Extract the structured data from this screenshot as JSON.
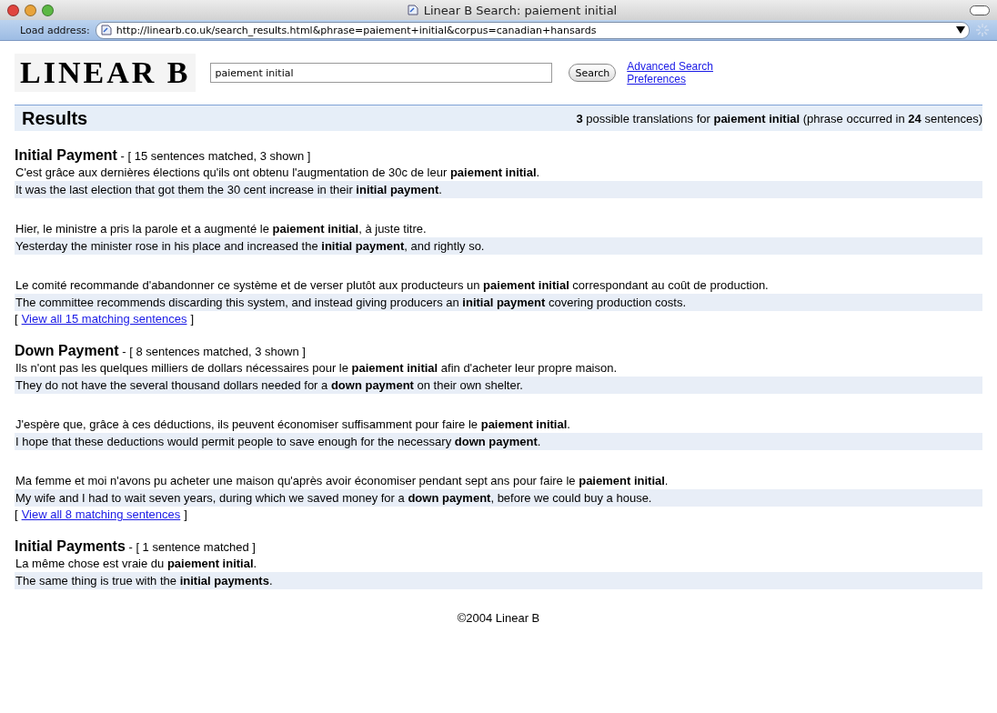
{
  "window": {
    "title": "Linear B Search: paiement initial"
  },
  "address_bar": {
    "label": "Load address:",
    "url": "http://linearb.co.uk/search_results.html&phrase=paiement+initial&corpus=canadian+hansards"
  },
  "logo": "LINEAR B",
  "search": {
    "value": "paiement initial",
    "button": "Search"
  },
  "links": [
    "Advanced Search",
    "Preferences"
  ],
  "results_header": {
    "title": "Results",
    "summary": "**3** possible translations for **paiement initial** (phrase occurred in **24** sentences)"
  },
  "translations": [
    {
      "title": "Initial Payment",
      "matched": " - [ 15 sentences matched, 3 shown ]",
      "sentences": [
        {
          "source": "C'est grâce aux dernières élections qu'ils ont obtenu l'augmentation de 30c de leur **paiement initial**.",
          "target": "It was the last election that got them the 30 cent increase in their **initial payment**."
        },
        {
          "source": "Hier, le ministre a pris la parole et a augmenté le **paiement initial**, à juste titre.",
          "target": "Yesterday the minister rose in his place and increased the **initial payment**, and rightly so."
        },
        {
          "source": "Le comité recommande d'abandonner ce système et de verser plutôt aux producteurs un **paiement initial** correspondant au coût de production.",
          "target": "The committee recommends discarding this system, and instead giving producers an **initial payment** covering production costs."
        }
      ],
      "view_all": {
        "open": "[",
        "link": "View all 15 matching sentences",
        "close": "]"
      }
    },
    {
      "title": "Down Payment",
      "matched": " - [ 8 sentences matched, 3 shown ]",
      "sentences": [
        {
          "source": "Ils n'ont pas les quelques milliers de dollars nécessaires pour le **paiement initial** afin d'acheter leur propre maison.",
          "target": "They do not have the several thousand dollars needed for a **down payment** on their own shelter."
        },
        {
          "source": "J'espère que, grâce à ces déductions, ils peuvent économiser suffisamment pour faire le **paiement initial**.",
          "target": "I hope that these deductions would permit people to save enough for the necessary **down payment**."
        },
        {
          "source": "Ma femme et moi n'avons pu acheter une maison qu'après avoir économiser pendant sept ans pour faire le **paiement initial**.",
          "target": "My wife and I had to wait seven years, during which we saved money for a **down payment**, before we could buy a house."
        }
      ],
      "view_all": {
        "open": "[",
        "link": "View all 8 matching sentences",
        "close": "]"
      }
    },
    {
      "title": "Initial Payments",
      "matched": " - [ 1 sentence matched ]",
      "sentences": [
        {
          "source": "La même chose est vraie du **paiement initial**.",
          "target": "The same thing is true with the **initial payments**."
        }
      ]
    }
  ],
  "footer": "©2004 Linear B"
}
